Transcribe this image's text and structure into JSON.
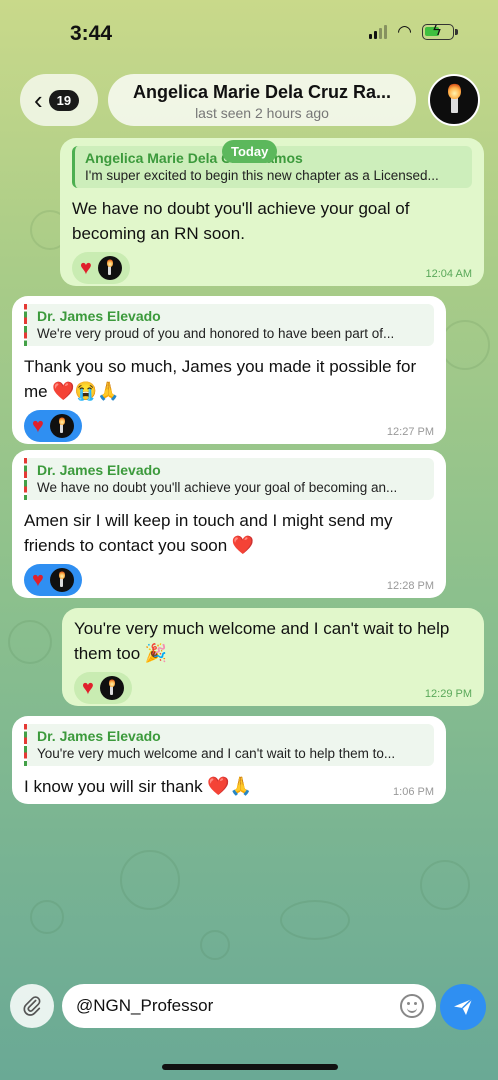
{
  "status_bar": {
    "time": "3:44"
  },
  "header": {
    "back_badge": "19",
    "title": "Angelica Marie Dela Cruz Ra...",
    "subtitle": "last seen 2 hours ago"
  },
  "date_pill": "Today",
  "messages": [
    {
      "reply_name": "Angelica Marie Dela Cruz Ramos",
      "reply_text": "I'm super excited to begin this new chapter as a Licensed...",
      "text": "We have no doubt you'll achieve your goal of becoming an RN soon.",
      "time": "12:04 AM"
    },
    {
      "reply_name": "Dr. James Elevado",
      "reply_text": "We're very proud of you and honored to have been part of...",
      "text": "Thank you so much, James you made it possible for me",
      "emojis": "❤️😭🙏",
      "time": "12:27 PM"
    },
    {
      "reply_name": "Dr. James Elevado",
      "reply_text": "We have no doubt you'll achieve your goal of becoming an...",
      "text": "Amen sir I will keep in touch and I might send my friends to contact you soon",
      "emojis": "❤️",
      "time": "12:28 PM"
    },
    {
      "text": "You're very much welcome and I can't wait to help them too",
      "emojis": "🎉",
      "time": "12:29 PM"
    },
    {
      "reply_name": "Dr. James Elevado",
      "reply_text": "You're very much welcome and I can't wait to help them to...",
      "text": "I know you will sir thank",
      "emojis": "❤️🙏",
      "time": "1:06 PM"
    }
  ],
  "input": {
    "value": "@NGN_Professor"
  },
  "colors": {
    "accent": "#2f8ff2",
    "outgoing_bubble": "#e1f7cb",
    "incoming_bubble": "#ffffff",
    "reply_name": "#3c9a3c"
  }
}
